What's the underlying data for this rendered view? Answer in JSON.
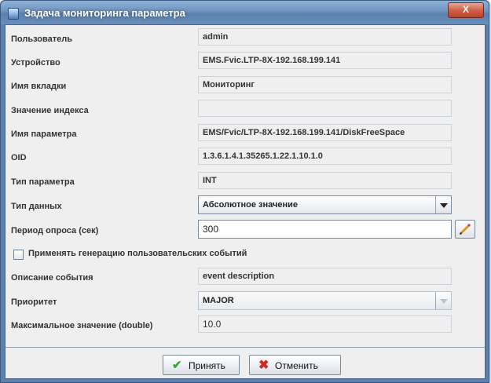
{
  "window": {
    "title": "Задача мониторинга параметра",
    "close_symbol": "X"
  },
  "form": {
    "user": {
      "label": "Пользователь",
      "value": "admin"
    },
    "device": {
      "label": "Устройство",
      "value": "EMS.Fvic.LTP-8X-192.168.199.141"
    },
    "tab_name": {
      "label": "Имя вкладки",
      "value": "Мониторинг"
    },
    "index_value": {
      "label": "Значение индекса",
      "value": ""
    },
    "param_name": {
      "label": "Имя параметра",
      "value": "EMS/Fvic/LTP-8X-192.168.199.141/DiskFreeSpace"
    },
    "oid": {
      "label": "OID",
      "value": "1.3.6.1.4.1.35265.1.22.1.10.1.0"
    },
    "param_type": {
      "label": "Тип параметра",
      "value": "INT"
    },
    "data_type": {
      "label": "Тип данных",
      "value": "Абсолютное значение"
    },
    "poll_period": {
      "label": "Период опроса (сек)",
      "value": "300"
    },
    "user_events_checkbox": {
      "label": "Применять генерацию пользовательских событий",
      "checked": false
    },
    "event_description": {
      "label": "Описание события",
      "value": "event description"
    },
    "priority": {
      "label": "Приоритет",
      "value": "MAJOR"
    },
    "max_value": {
      "label": "Максимальное значение (double)",
      "value": "10.0"
    }
  },
  "buttons": {
    "accept": "Принять",
    "cancel": "Отменить"
  },
  "icons": {
    "app": "window-app-icon",
    "edit": "pencil-icon",
    "accept": "checkmark-icon",
    "cancel": "red-cross-icon",
    "dropdown": "chevron-down-icon"
  },
  "colors": {
    "titlebar": "#6f93bf",
    "client_bg": "#efefef",
    "accept_icon": "#3fa63a",
    "cancel_icon": "#d12a1a"
  }
}
